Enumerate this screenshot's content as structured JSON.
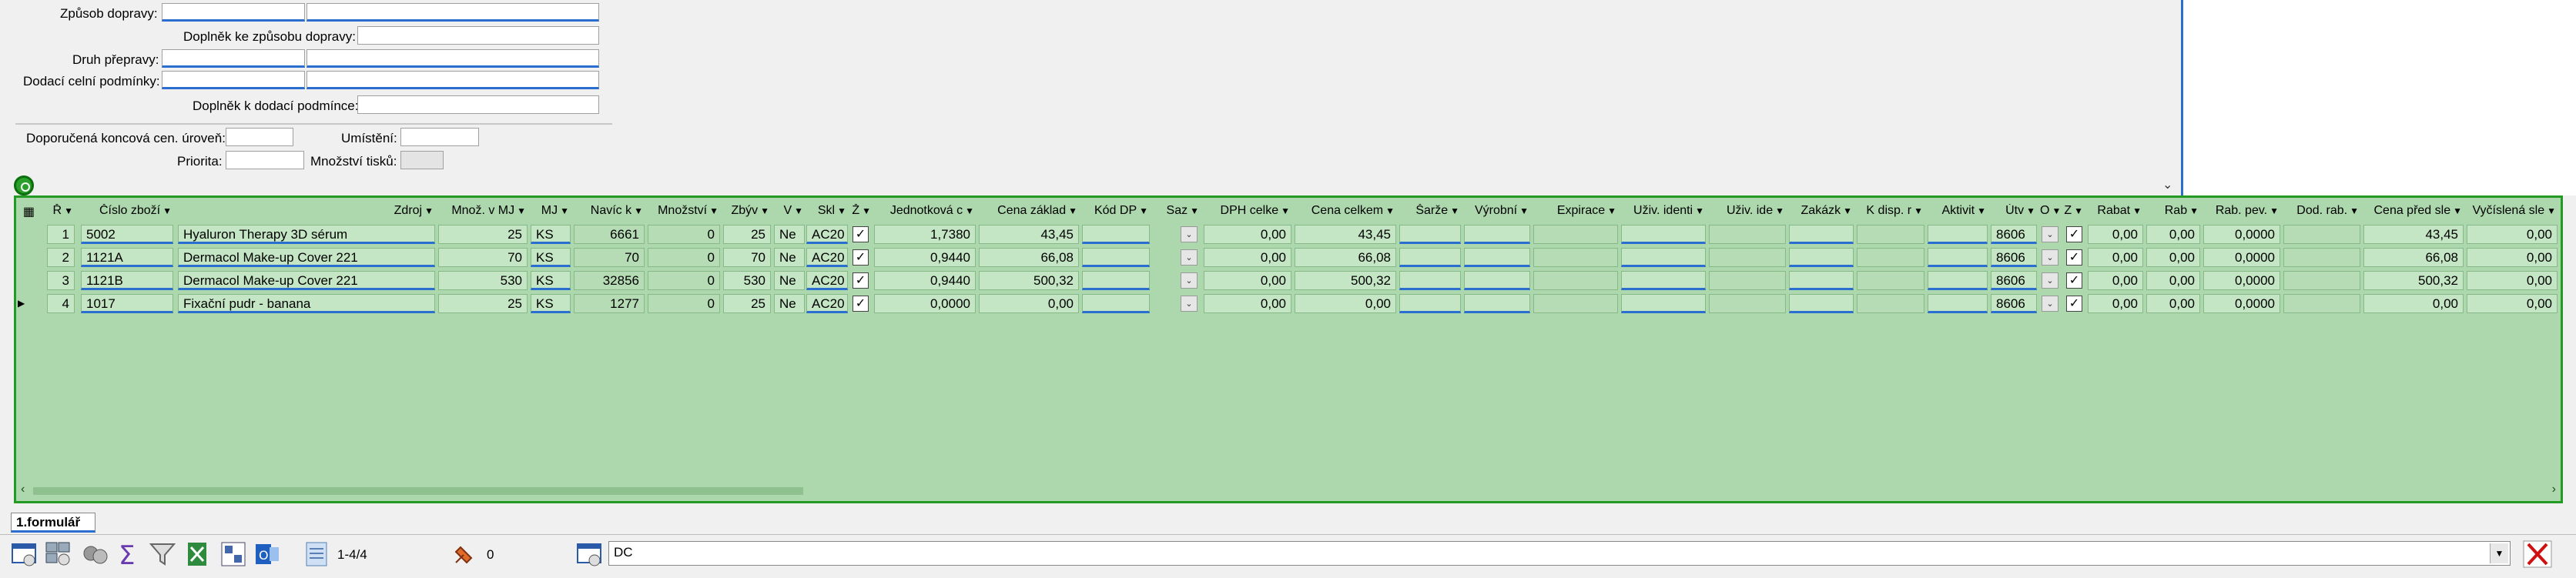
{
  "form": {
    "zpusob_dopravy": "Způsob dopravy:",
    "doplnek_zpusob": "Doplněk ke způsobu dopravy:",
    "druh_prepravy": "Druh přepravy:",
    "dodaci_podminky": "Dodací celní podmínky:",
    "doplnek_dodaci": "Doplněk k dodací podmínce:",
    "doporucena": "Doporučená koncová cen. úroveň:",
    "umisteni": "Umístění:",
    "priorita": "Priorita:",
    "mnozstvi_tisku": "Množství tisků:"
  },
  "grid": {
    "headers": [
      "Ř",
      "Číslo zboží",
      "Zdroj",
      "Množ. v MJ",
      "MJ",
      "Navíc k",
      "Množství",
      "Zbýv",
      "V",
      "Skl",
      "Ž",
      "Jednotková c",
      "Cena základ",
      "Kód DP",
      "Saz",
      "DPH celke",
      "Cena celkem",
      "Šarže",
      "Výrobní",
      "Expirace",
      "Uživ. identi",
      "Uživ. ide",
      "Zakázk",
      "K disp. r",
      "Aktivit",
      "Útv",
      "O",
      "Z",
      "Rabat",
      "Rab",
      "Rab. pev.",
      "Dod. rab.",
      "Cena před sle",
      "Vyčíslená sle"
    ],
    "rows": [
      {
        "n": "1",
        "code": "5002",
        "name": "Hyaluron Therapy 3D sérum",
        "qty": "25",
        "mj": "KS",
        "navic": "6661",
        "mnoz": "0",
        "zbyv": "25",
        "v": "Ne",
        "skl": "AC20",
        "unit": "1,7380",
        "base": "43,45",
        "dph": "0,00",
        "total": "43,45",
        "utv": "8606",
        "rabat": "0,00",
        "rab": "0,00",
        "rabpev": "0,0000",
        "cenapred": "43,45",
        "vycisl": "0,00"
      },
      {
        "n": "2",
        "code": "1121A",
        "name": "Dermacol Make-up Cover 221",
        "qty": "70",
        "mj": "KS",
        "navic": "70",
        "mnoz": "0",
        "zbyv": "70",
        "v": "Ne",
        "skl": "AC20",
        "unit": "0,9440",
        "base": "66,08",
        "dph": "0,00",
        "total": "66,08",
        "utv": "8606",
        "rabat": "0,00",
        "rab": "0,00",
        "rabpev": "0,0000",
        "cenapred": "66,08",
        "vycisl": "0,00"
      },
      {
        "n": "3",
        "code": "1121B",
        "name": "Dermacol Make-up Cover 221",
        "qty": "530",
        "mj": "KS",
        "navic": "32856",
        "mnoz": "0",
        "zbyv": "530",
        "v": "Ne",
        "skl": "AC20",
        "unit": "0,9440",
        "base": "500,32",
        "dph": "0,00",
        "total": "500,32",
        "utv": "8606",
        "rabat": "0,00",
        "rab": "0,00",
        "rabpev": "0,0000",
        "cenapred": "500,32",
        "vycisl": "0,00"
      },
      {
        "n": "4",
        "code": "1017",
        "name": "Fixační pudr - banana",
        "qty": "25",
        "mj": "KS",
        "navic": "1277",
        "mnoz": "0",
        "zbyv": "25",
        "v": "Ne",
        "skl": "AC20",
        "unit": "0,0000",
        "base": "0,00",
        "dph": "0,00",
        "total": "0,00",
        "utv": "8606",
        "rabat": "0,00",
        "rab": "0,00",
        "rabpev": "0,0000",
        "cenapred": "0,00",
        "vycisl": "0,00"
      }
    ]
  },
  "tabs": {
    "first": "1.formulář"
  },
  "status": {
    "records": "1-4/4",
    "count": "0",
    "combo_value": "DC"
  },
  "colors": {
    "grid_bg": "#add8ad",
    "grid_border": "#239a23",
    "accent_blue": "#2a6fcf"
  }
}
